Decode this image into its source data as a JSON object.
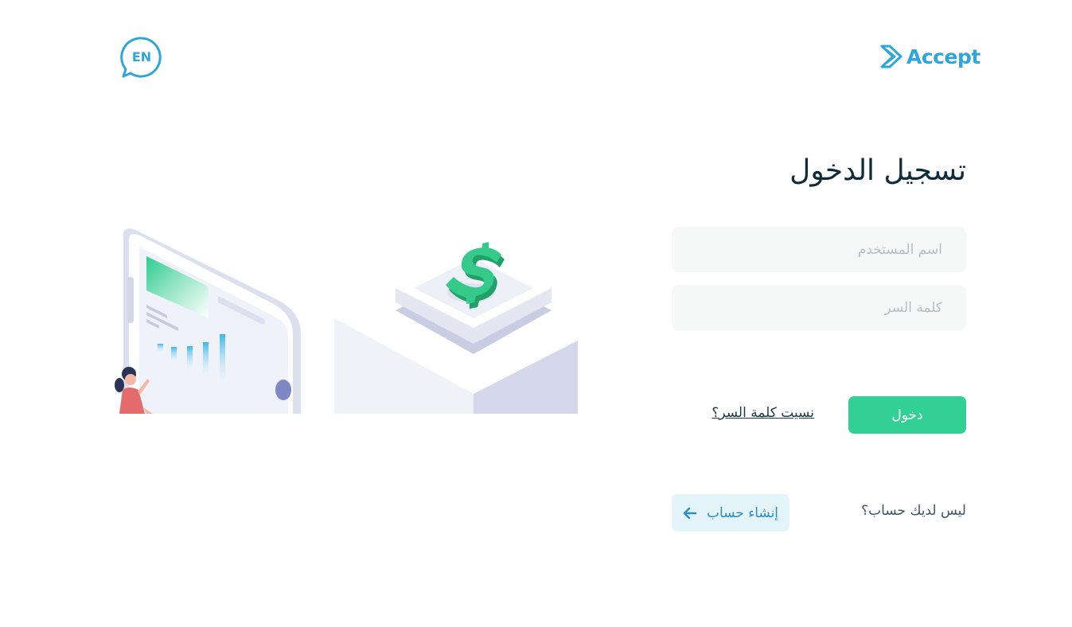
{
  "app": {
    "brand_name": "Accept",
    "language_toggle": "EN",
    "colors": {
      "brand": "#2ea6dc",
      "primary_button": "#33d096",
      "secondary_button_bg": "#e3f4fb",
      "input_bg": "#f6f8f8",
      "title": "#0e2b3a"
    }
  },
  "login": {
    "title": "تسجيل الدخول",
    "username_placeholder": "اسم المستخدم",
    "username_value": "",
    "password_placeholder": "كلمة السر",
    "password_value": "",
    "submit_label": "دخول",
    "forgot_password_label": "نسيت كلمة السر؟"
  },
  "signup": {
    "prompt": "ليس لديك حساب؟",
    "button_label": "إنشاء حساب",
    "button_icon": "arrow-left-icon"
  },
  "hero": {
    "illustration": "payment-dashboard-illustration",
    "currency_symbol_icon": "dollar-icon"
  }
}
